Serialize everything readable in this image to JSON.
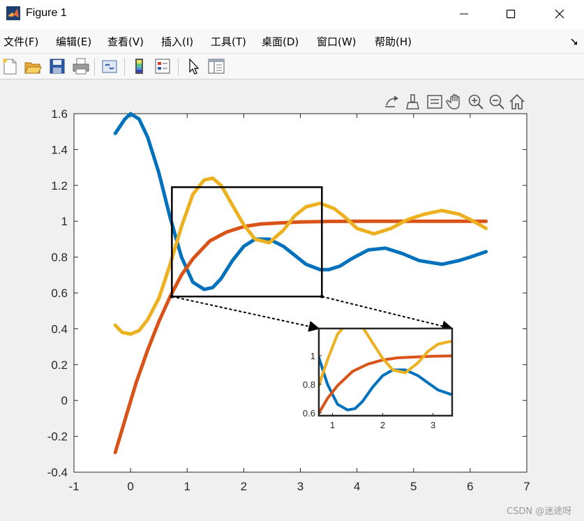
{
  "window": {
    "title": "Figure 1",
    "controls": [
      "minimize",
      "maximize",
      "close"
    ]
  },
  "menubar": {
    "items": [
      "文件(F)",
      "编辑(E)",
      "查看(V)",
      "插入(I)",
      "工具(T)",
      "桌面(D)",
      "窗口(W)",
      "帮助(H)"
    ]
  },
  "toolbar": {
    "buttons": [
      "new-figure-icon",
      "open-file-icon",
      "save-icon",
      "print-icon",
      "link-plot-icon",
      "colorbar-icon",
      "legend-icon",
      "pointer-icon",
      "property-inspector-icon"
    ]
  },
  "axes_toolbar": {
    "buttons": [
      "export-icon",
      "brush-icon",
      "datatip-icon",
      "pan-hand-icon",
      "zoom-in-icon",
      "zoom-out-icon",
      "home-icon"
    ]
  },
  "watermark": "CSDN @迷途呀",
  "colors": {
    "series1": "#0072BD",
    "series2": "#D95319",
    "series3": "#EDB120",
    "highlight_box": "#000000"
  },
  "chart_data": [
    {
      "type": "line",
      "role": "main",
      "xlim": [
        -1,
        7
      ],
      "ylim": [
        -0.4,
        1.6
      ],
      "xticks": [
        "-1",
        "0",
        "1",
        "2",
        "3",
        "4",
        "5",
        "6",
        "7"
      ],
      "yticks": [
        "-0.4",
        "-0.2",
        "0",
        "0.2",
        "0.4",
        "0.6",
        "0.8",
        "1",
        "1.2",
        "1.4",
        "1.6"
      ],
      "grid": false,
      "series": [
        {
          "color": "#0072BD",
          "x": [
            -0.27,
            -0.1,
            0.0,
            0.15,
            0.3,
            0.5,
            0.7,
            0.9,
            1.1,
            1.3,
            1.45,
            1.6,
            1.8,
            2.0,
            2.2,
            2.45,
            2.7,
            2.9,
            3.1,
            3.35,
            3.5,
            3.7,
            3.9,
            4.2,
            4.5,
            4.8,
            5.1,
            5.5,
            5.8,
            6.0,
            6.28
          ],
          "y": [
            1.49,
            1.57,
            1.6,
            1.57,
            1.47,
            1.27,
            1.02,
            0.8,
            0.66,
            0.62,
            0.63,
            0.68,
            0.78,
            0.86,
            0.9,
            0.9,
            0.86,
            0.81,
            0.76,
            0.73,
            0.73,
            0.75,
            0.79,
            0.84,
            0.85,
            0.82,
            0.78,
            0.76,
            0.78,
            0.8,
            0.83
          ]
        },
        {
          "color": "#D95319",
          "x": [
            -0.27,
            -0.1,
            0.1,
            0.3,
            0.5,
            0.7,
            0.9,
            1.1,
            1.4,
            1.7,
            2.0,
            2.3,
            2.6,
            3.0,
            3.5,
            4.0,
            5.0,
            6.28
          ],
          "y": [
            -0.29,
            -0.11,
            0.1,
            0.28,
            0.44,
            0.58,
            0.7,
            0.79,
            0.89,
            0.94,
            0.97,
            0.985,
            0.99,
            0.996,
            0.999,
            1.0,
            1.0,
            1.0
          ]
        },
        {
          "color": "#EDB120",
          "x": [
            -0.27,
            -0.15,
            0.0,
            0.15,
            0.3,
            0.5,
            0.7,
            0.9,
            1.1,
            1.3,
            1.45,
            1.6,
            1.8,
            2.0,
            2.2,
            2.45,
            2.7,
            2.9,
            3.1,
            3.35,
            3.6,
            3.8,
            4.0,
            4.3,
            4.6,
            4.9,
            5.2,
            5.5,
            5.8,
            6.0,
            6.28
          ],
          "y": [
            0.42,
            0.38,
            0.37,
            0.39,
            0.45,
            0.57,
            0.76,
            0.97,
            1.15,
            1.23,
            1.24,
            1.2,
            1.09,
            0.98,
            0.9,
            0.88,
            0.95,
            1.03,
            1.08,
            1.1,
            1.07,
            1.02,
            0.96,
            0.93,
            0.96,
            1.01,
            1.04,
            1.06,
            1.04,
            1.01,
            0.96
          ]
        }
      ],
      "highlight_box": {
        "x": [
          0.73,
          3.38
        ],
        "y": [
          0.58,
          1.19
        ]
      }
    },
    {
      "type": "line",
      "role": "inset",
      "xlim": [
        0.73,
        3.38
      ],
      "ylim": [
        0.58,
        1.19
      ],
      "xticks": [
        "1",
        "2",
        "3"
      ],
      "yticks": [
        "0.6",
        "0.8",
        "1"
      ],
      "grid": false
    }
  ]
}
